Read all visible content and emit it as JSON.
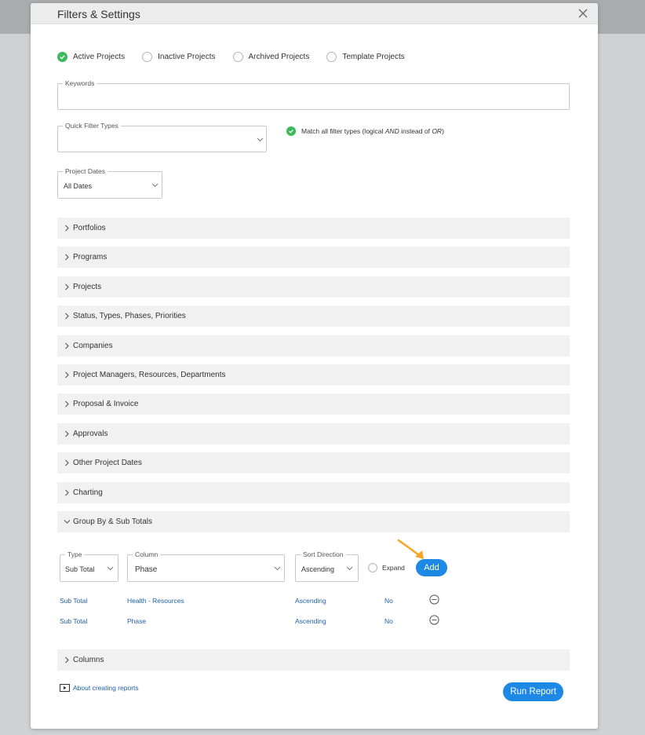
{
  "modal": {
    "title": "Filters & Settings"
  },
  "project_filters": [
    {
      "label": "Active Projects",
      "checked": true
    },
    {
      "label": "Inactive Projects",
      "checked": false
    },
    {
      "label": "Archived Projects",
      "checked": false
    },
    {
      "label": "Template Projects",
      "checked": false
    }
  ],
  "keywords": {
    "legend": "Keywords",
    "value": ""
  },
  "quick_filter": {
    "legend": "Quick Filter Types",
    "value": ""
  },
  "match_all": {
    "pre": "Match all filter types (logical ",
    "and": "AND",
    "mid": " instead of ",
    "or": "OR",
    "post": ")"
  },
  "project_dates": {
    "legend": "Project Dates",
    "value": "All Dates"
  },
  "sections": [
    "Portfolios",
    "Programs",
    "Projects",
    "Status, Types, Phases, Priorities",
    "Companies",
    "Project Managers, Resources, Departments",
    "Proposal & Invoice",
    "Approvals",
    "Other Project Dates",
    "Charting",
    "Group By & Sub Totals"
  ],
  "group_by": {
    "type": {
      "legend": "Type",
      "value": "Sub Total"
    },
    "column": {
      "legend": "Column",
      "value": "Phase"
    },
    "sort": {
      "legend": "Sort Direction",
      "value": "Ascending"
    },
    "expand_label": "Expand",
    "add_label": "Add",
    "rows": [
      {
        "type": "Sub Total",
        "column": "Health - Resources",
        "sort": "Ascending",
        "expand": "No"
      },
      {
        "type": "Sub Total",
        "column": "Phase",
        "sort": "Ascending",
        "expand": "No"
      }
    ]
  },
  "columns_section": "Columns",
  "footer": {
    "about_link": "About creating reports",
    "run_label": "Run Report"
  },
  "colors": {
    "accent": "#1e88e5",
    "check": "#3cb95b",
    "annotation": "#f5a623"
  }
}
